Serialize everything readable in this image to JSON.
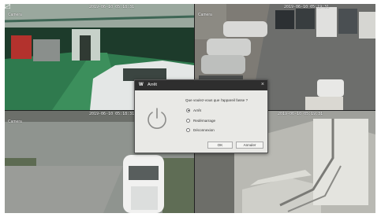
{
  "cameras": [
    {
      "timestamp": "2019-06-10 05:18:31",
      "label": "Camera"
    },
    {
      "timestamp": "2019-06-10 05:19:31",
      "label": "Camera"
    },
    {
      "timestamp": "2019-06-10 05:18:31",
      "label": "Camera"
    },
    {
      "timestamp": "2019-06-10 05:19:31",
      "label": ""
    }
  ],
  "dialog": {
    "title": "Arrêt",
    "question": "Que voulez-vous que l'appareil fasse ?",
    "options": [
      {
        "label": "Arrêt",
        "selected": true
      },
      {
        "label": "Redémarrage",
        "selected": false
      },
      {
        "label": "Déconnexion",
        "selected": false
      }
    ],
    "ok_label": "OK",
    "cancel_label": "Annuler",
    "close_glyph": "×",
    "logo_glyph": "W"
  },
  "colors": {
    "title_bar": "#2e2e2e",
    "dialog_bg": "#e9e9e6"
  }
}
